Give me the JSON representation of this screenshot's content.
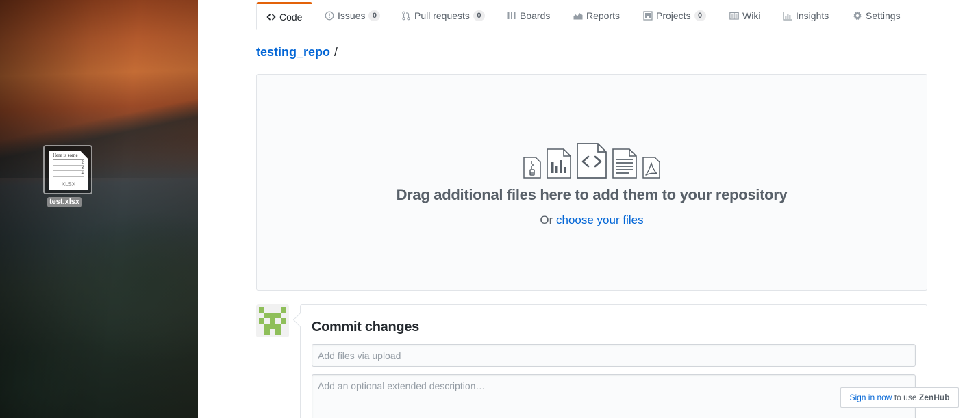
{
  "desktop": {
    "file": {
      "name": "test.xlsx",
      "preview_text": "Here is some",
      "preview_rows": [
        "2",
        "3",
        "4"
      ],
      "preview_ext": "XLSX"
    }
  },
  "repo_nav": {
    "tabs": [
      {
        "label": "Code",
        "icon": "code-icon",
        "counter": null,
        "selected": true
      },
      {
        "label": "Issues",
        "icon": "issue-icon",
        "counter": "0"
      },
      {
        "label": "Pull requests",
        "icon": "git-pull-request-icon",
        "counter": "0"
      },
      {
        "label": "Boards",
        "icon": "boards-icon",
        "counter": null
      },
      {
        "label": "Reports",
        "icon": "graph-icon",
        "counter": null
      },
      {
        "label": "Projects",
        "icon": "project-icon",
        "counter": "0"
      },
      {
        "label": "Wiki",
        "icon": "book-icon",
        "counter": null
      },
      {
        "label": "Insights",
        "icon": "insights-icon",
        "counter": null
      },
      {
        "label": "Settings",
        "icon": "gear-icon",
        "counter": null
      }
    ]
  },
  "breadcrumb": {
    "repo": "testing_repo",
    "separator": "/"
  },
  "upload": {
    "icons": [
      "file-zip-icon",
      "file-chart-icon",
      "file-code-icon",
      "file-text-icon",
      "file-pdf-icon"
    ],
    "drag_text": "Drag additional files here to add them to your repository",
    "or_text": "Or",
    "choose_link": "choose your files"
  },
  "commit": {
    "title": "Commit changes",
    "summary_placeholder": "Add files via upload",
    "description_placeholder": "Add an optional extended description…"
  },
  "zenhub": {
    "link": "Sign in now",
    "text": "to use",
    "brand": "ZenHub"
  },
  "colors": {
    "link": "#0366d6",
    "tab_accent": "#e36209",
    "avatar": "#8fbf5a"
  }
}
